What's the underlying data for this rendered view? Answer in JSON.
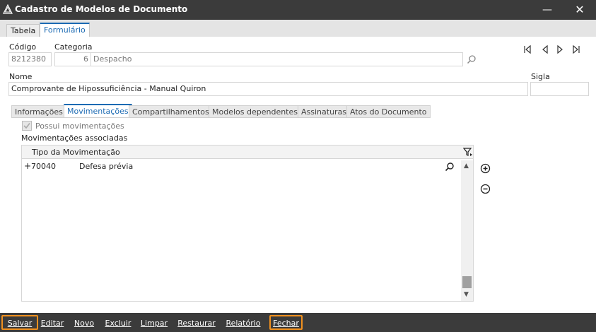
{
  "window": {
    "title": "Cadastro de Modelos de Documento",
    "minimize_glyph": "—",
    "close_glyph": "✕"
  },
  "top_tabs": [
    {
      "label": "Tabela",
      "active": false
    },
    {
      "label": "Formulário",
      "active": true
    }
  ],
  "form": {
    "codigo_label": "Código",
    "codigo_value": "8212380",
    "categoria_label": "Categoria",
    "categoria_code": "6",
    "categoria_desc": "Despacho",
    "nome_label": "Nome",
    "nome_value": "Comprovante de Hipossuficiência - Manual Quiron",
    "sigla_label": "Sigla",
    "sigla_value": ""
  },
  "sub_tabs": [
    {
      "label": "Informações",
      "active": false
    },
    {
      "label": "Movimentações",
      "active": true
    },
    {
      "label": "Compartilhamentos",
      "active": false
    },
    {
      "label": "Modelos dependentes",
      "active": false
    },
    {
      "label": "Assinaturas",
      "active": false
    },
    {
      "label": "Atos do Documento",
      "active": false
    }
  ],
  "movimentacoes": {
    "possui_label": "Possui movimentações",
    "possui_checked": true,
    "associadas_label": "Movimentações associadas",
    "column_header": "Tipo da Movimentação",
    "rows": [
      {
        "expander": "+",
        "code": "70040",
        "description": "Defesa prévia"
      }
    ]
  },
  "footer_buttons": [
    {
      "label": "Salvar",
      "highlighted": true
    },
    {
      "label": "Editar",
      "highlighted": false
    },
    {
      "label": "Novo",
      "highlighted": false
    },
    {
      "label": "Excluir",
      "highlighted": false
    },
    {
      "label": "Limpar",
      "highlighted": false
    },
    {
      "label": "Restaurar",
      "highlighted": false
    },
    {
      "label": "Relatório",
      "highlighted": false
    },
    {
      "label": "Fechar",
      "highlighted": true
    }
  ],
  "colors": {
    "titlebar": "#3b3b3b",
    "accent": "#1b6ab3",
    "highlight": "#f0901e"
  },
  "icons": {
    "app": "app-logo-icon",
    "lookup": "magnifier-icon",
    "nav": [
      "first-record-icon",
      "previous-record-icon",
      "next-record-icon",
      "last-record-icon"
    ],
    "filter": "filter-icon",
    "add": "add-circle-icon",
    "remove": "remove-circle-icon"
  }
}
